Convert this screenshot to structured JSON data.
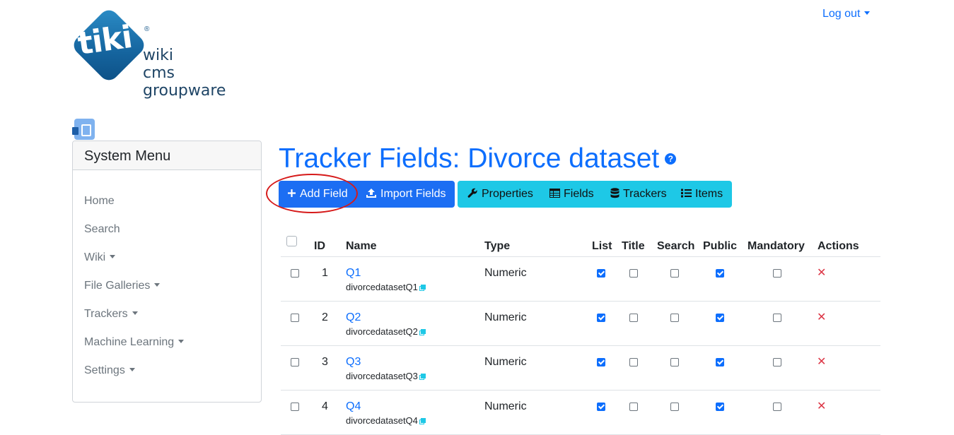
{
  "logo": {
    "mark_text": "tiki",
    "registered": "®",
    "line1": "wiki",
    "line2": "cms",
    "line3": "groupware"
  },
  "header": {
    "logout_label": "Log out"
  },
  "sidebar": {
    "title": "System Menu",
    "items": [
      {
        "label": "Home"
      },
      {
        "label": "Search"
      },
      {
        "label": "Wiki"
      },
      {
        "label": "File Galleries"
      },
      {
        "label": "Trackers"
      },
      {
        "label": "Machine Learning"
      },
      {
        "label": "Settings"
      }
    ]
  },
  "page": {
    "title": "Tracker Fields: Divorce dataset",
    "help_icon": "?"
  },
  "toolbar": {
    "add_field": "Add Field",
    "import_fields": "Import Fields",
    "properties": "Properties",
    "fields": "Fields",
    "trackers": "Trackers",
    "items": "Items"
  },
  "table": {
    "columns": {
      "id": "ID",
      "name": "Name",
      "type": "Type",
      "list": "List",
      "title": "Title",
      "search": "Search",
      "public": "Public",
      "mandatory": "Mandatory",
      "actions": "Actions"
    },
    "rows": [
      {
        "id": "1",
        "name": "Q1",
        "perm": "divorcedatasetQ1",
        "type": "Numeric",
        "list": true,
        "title": false,
        "search": false,
        "public": true,
        "mandatory": false
      },
      {
        "id": "2",
        "name": "Q2",
        "perm": "divorcedatasetQ2",
        "type": "Numeric",
        "list": true,
        "title": false,
        "search": false,
        "public": true,
        "mandatory": false
      },
      {
        "id": "3",
        "name": "Q3",
        "perm": "divorcedatasetQ3",
        "type": "Numeric",
        "list": true,
        "title": false,
        "search": false,
        "public": true,
        "mandatory": false
      },
      {
        "id": "4",
        "name": "Q4",
        "perm": "divorcedatasetQ4",
        "type": "Numeric",
        "list": true,
        "title": false,
        "search": false,
        "public": true,
        "mandatory": false
      }
    ]
  },
  "colors": {
    "primary": "#1c6ef3",
    "info": "#1ec8e6",
    "danger": "#dc3545",
    "annotation": "#d61a1a"
  }
}
